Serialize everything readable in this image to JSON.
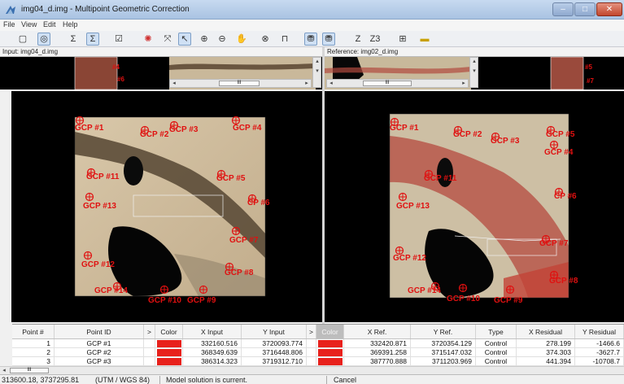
{
  "window": {
    "title": "img04_d.img - Multipoint Geometric Correction",
    "controls": {
      "minimize": "–",
      "maximize": "□",
      "close": "✕"
    }
  },
  "menu": [
    "File",
    "View",
    "Edit",
    "Help"
  ],
  "toolbar": {
    "icons": [
      "model-icon",
      "gcp-tool-icon",
      "sum-icon",
      "sum-selected-icon",
      "checkbox-icon",
      "globe-red-icon",
      "fit-window-icon",
      "select-arrow-icon",
      "zoom-in-icon",
      "zoom-out-icon",
      "pan-hand-icon",
      "crosshair-icon",
      "lock-icon",
      "binoculars-icon",
      "binoculars-auto-icon",
      "z-icon",
      "z-three-icon",
      "gcp-table-icon",
      "ruler-icon"
    ],
    "glyphs": [
      "▢",
      "◎",
      "Σ",
      "Σ",
      "☑",
      "✺",
      "⤧",
      "↖",
      "⊕",
      "⊖",
      "✋",
      "⊗",
      "⊓",
      "⛃",
      "⛃",
      "Z",
      "Z3",
      "⊞",
      "▬"
    ]
  },
  "input_panel": {
    "label": "Input: img04_d.img"
  },
  "reference_panel": {
    "label": "Reference: img02_d.img"
  },
  "overview": {
    "scroll_glyph": "III",
    "gcp_marks": [
      "#4",
      "#6",
      "#5",
      "#7"
    ]
  },
  "input_gcps": [
    "GCP #1",
    "GCP #2",
    "GCP #3",
    "GCP #4",
    "GCP #11",
    "GCP #5",
    "GCP #13",
    "CP #6",
    "GCP #7",
    "GCP #12",
    "GCP #8",
    "GCP #14",
    "GCP #10",
    "GCP #9"
  ],
  "reference_gcps": [
    "GCP #1",
    "GCP #2",
    "GCP #3",
    "GCP #5",
    "GCP #4",
    "GCP #11",
    "CP #6",
    "GCP #13",
    "GCP #7",
    "GCP #12",
    "GCP #8",
    "GCP #14",
    "GCP #10",
    "GCP #9"
  ],
  "table": {
    "headers": [
      "Point #",
      "Point ID",
      ">",
      "Color",
      "X Input",
      "Y Input",
      ">",
      "Color",
      "X Ref.",
      "Y Ref.",
      "Type",
      "X Residual",
      "Y Residual"
    ],
    "color_hex": "#e8211c",
    "rows": [
      {
        "n": "1",
        "id": "GCP #1",
        "xin": "332160.516",
        "yin": "3720093.774",
        "xref": "332420.871",
        "yref": "3720354.129",
        "type": "Control",
        "xres": "278.199",
        "yres": "-1466.6"
      },
      {
        "n": "2",
        "id": "GCP #2",
        "xin": "368349.639",
        "yin": "3716448.806",
        "xref": "369391.258",
        "yref": "3715147.032",
        "type": "Control",
        "xres": "374.303",
        "yres": "-3627.7"
      },
      {
        "n": "3",
        "id": "GCP #3",
        "xin": "386314.323",
        "yin": "3719312.710",
        "xref": "387770.888",
        "yref": "3711203.969",
        "type": "Control",
        "xres": "441.394",
        "yres": "-10708.7"
      }
    ]
  },
  "scroll": {
    "left": "◂",
    "thumb": "III",
    "up": "▴",
    "down": "▾",
    "right": "▸"
  },
  "status": {
    "coords": "313600.18, 3737295.81",
    "projection": "(UTM / WGS 84)",
    "message": "Model solution is current.",
    "action": "Cancel"
  }
}
